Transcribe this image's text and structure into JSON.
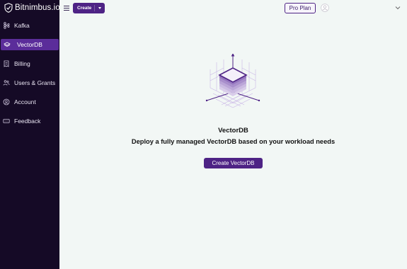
{
  "brand": {
    "name": "Bitnimbus.io",
    "logo_icon": "shield-logo-icon"
  },
  "sidebar": {
    "items": [
      {
        "label": "Kafka",
        "icon": "kafka-icon",
        "active": false
      },
      {
        "label": "VectorDB",
        "icon": "vectordb-icon",
        "active": true
      },
      {
        "label": "Billing",
        "icon": "billing-icon",
        "active": false
      },
      {
        "label": "Users & Grants",
        "icon": "users-icon",
        "active": false
      },
      {
        "label": "Account",
        "icon": "account-icon",
        "active": false
      },
      {
        "label": "Feedback",
        "icon": "feedback-icon",
        "active": false
      }
    ]
  },
  "toolbar": {
    "menu_icon": "hamburger-icon",
    "create_label": "Create",
    "plan_label": "Pro Plan",
    "avatar_icon": "user-avatar-icon",
    "expand_icon": "chevron-down-icon"
  },
  "empty_state": {
    "illustration": "vectordb-stack-illustration",
    "title": "VectorDB",
    "subtitle": "Deploy a fully managed VectorDB based on your workload needs",
    "cta_label": "Create VectorDB"
  },
  "colors": {
    "sidebar_bg": "#150a26",
    "accent": "#4e2385",
    "active_item": "#5b2d9a",
    "page_bg": "#f2f7f5"
  }
}
